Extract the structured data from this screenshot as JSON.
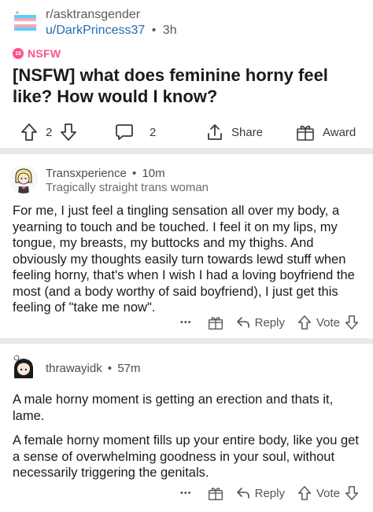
{
  "post": {
    "subreddit": "r/asktransgender",
    "author": "u/DarkPrincess37",
    "separator": "•",
    "age": "3h",
    "nsfw_badge_num": "18",
    "nsfw_label": "NSFW",
    "title": "[NSFW] what does feminine horny feel like? How would I know?",
    "actions": {
      "upvotes": "2",
      "comments": "2",
      "share_label": "Share",
      "award_label": "Award"
    }
  },
  "comments": [
    {
      "author": "Transxperience",
      "separator": "•",
      "age": "10m",
      "flair": "Tragically straight trans woman",
      "paragraphs": [
        "For me, I just feel a tingling sensation all over my body, a yearning to touch and be touched. I feel it on my lips, my tongue, my breasts, my buttocks and my thighs. And obviously my thoughts easily turn towards lewd stuff when feeling horny, that's when I wish I had a loving boyfriend the most (and a body worthy of said boyfriend), I just get this feeling of \"take me now\"."
      ],
      "more": "•••",
      "reply_label": "Reply",
      "vote_label": "Vote"
    },
    {
      "author": "thrawayidk",
      "separator": "•",
      "age": "57m",
      "flair": "",
      "paragraphs": [
        "A male horny moment is getting an erection and thats it, lame.",
        "A female horny moment fills up your entire body, like you get a sense of overwhelming goodness in your soul, without necessarily triggering the genitals."
      ],
      "more": "•••",
      "reply_label": "Reply",
      "vote_label": "Vote"
    }
  ],
  "colors": {
    "nsfw": "#ff4f8b",
    "username_link": "#1f6fb3",
    "divider": "#e9e9ea",
    "text": "#1a1a1b",
    "meta": "#5b5b5b"
  },
  "icons": [
    "subreddit-trans-flag-icon",
    "upvote-arrow-icon",
    "downvote-arrow-icon",
    "comment-bubble-icon",
    "share-icon",
    "award-icon",
    "more-dots-icon",
    "reply-arrow-icon"
  ]
}
